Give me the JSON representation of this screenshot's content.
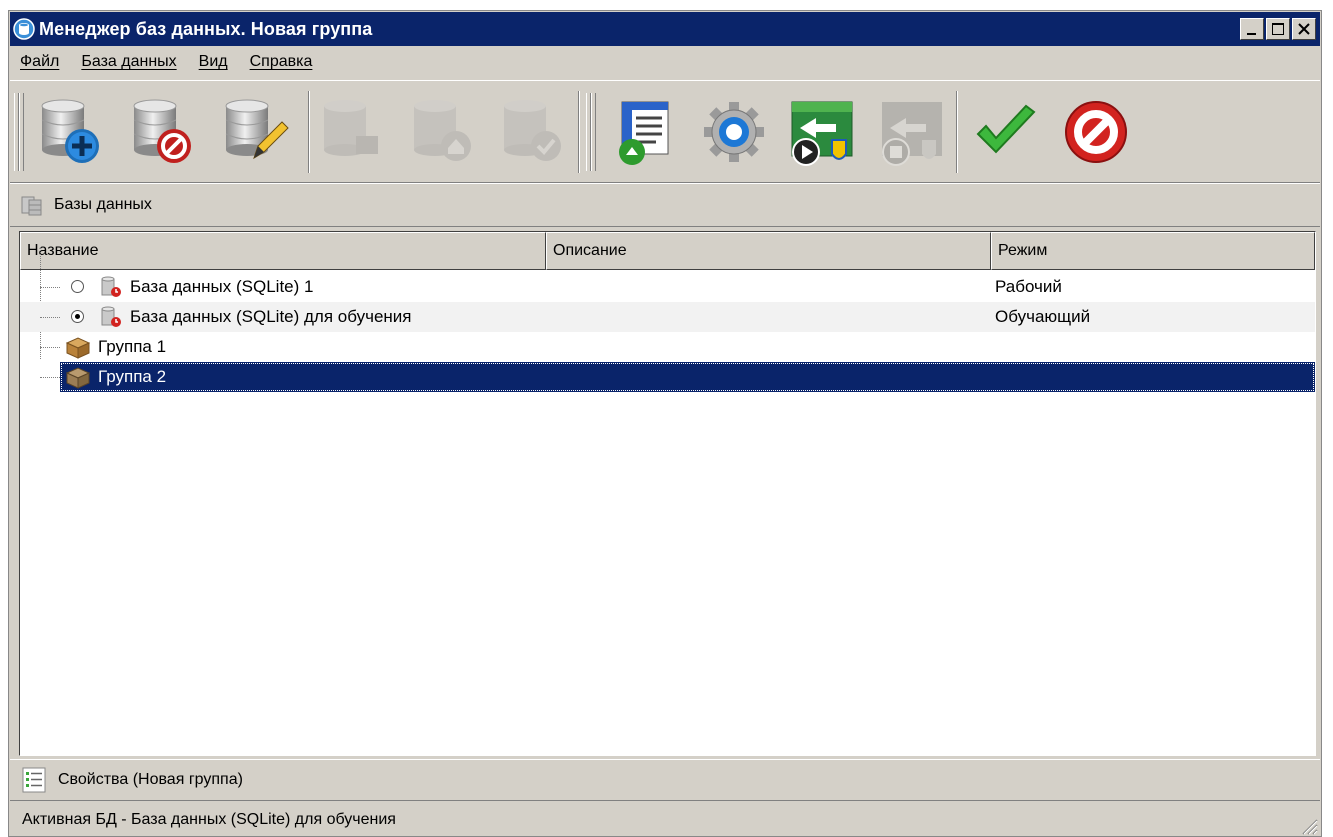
{
  "window": {
    "title": "Менеджер баз данных. Новая группа",
    "accent_color": "#0a246a",
    "face_color": "#d4d0c8"
  },
  "menu": {
    "items": [
      {
        "label": "Файл"
      },
      {
        "label": "База данных"
      },
      {
        "label": "Вид"
      },
      {
        "label": "Справка"
      }
    ]
  },
  "toolbar": {
    "buttons": [
      {
        "icon": "add-database-icon",
        "enabled": true
      },
      {
        "icon": "delete-database-icon",
        "enabled": true
      },
      {
        "icon": "edit-database-icon",
        "enabled": true
      },
      {
        "icon": "database-disabled-icon",
        "enabled": false
      },
      {
        "icon": "database-home-disabled-icon",
        "enabled": false
      },
      {
        "icon": "database-check-disabled-icon",
        "enabled": false
      },
      {
        "icon": "open-window-icon",
        "enabled": true
      },
      {
        "icon": "settings-gear-icon",
        "enabled": true
      },
      {
        "icon": "start-service-icon",
        "enabled": true
      },
      {
        "icon": "stop-service-disabled-icon",
        "enabled": false
      },
      {
        "icon": "confirm-check-icon",
        "enabled": true
      },
      {
        "icon": "cancel-icon",
        "enabled": true
      }
    ]
  },
  "breadcrumb": {
    "icon": "databases-icon",
    "label": "Базы данных"
  },
  "table": {
    "columns": [
      "Название",
      "Описание",
      "Режим"
    ],
    "rows": [
      {
        "type": "database",
        "radio_checked": false,
        "name": "База данных (SQLite) 1",
        "description": "",
        "mode": "Рабочий"
      },
      {
        "type": "database",
        "radio_checked": true,
        "name": "База данных (SQLite) для обучения",
        "description": "",
        "mode": "Обучающий"
      },
      {
        "type": "group",
        "name": "Группа 1",
        "description": "",
        "mode": ""
      },
      {
        "type": "group",
        "name": "Группа 2",
        "description": "",
        "mode": "",
        "selected": true
      }
    ]
  },
  "properties": {
    "icon": "properties-list-icon",
    "label": "Свойства (Новая группа)"
  },
  "status": {
    "text": "Активная БД - База данных (SQLite) для обучения"
  }
}
